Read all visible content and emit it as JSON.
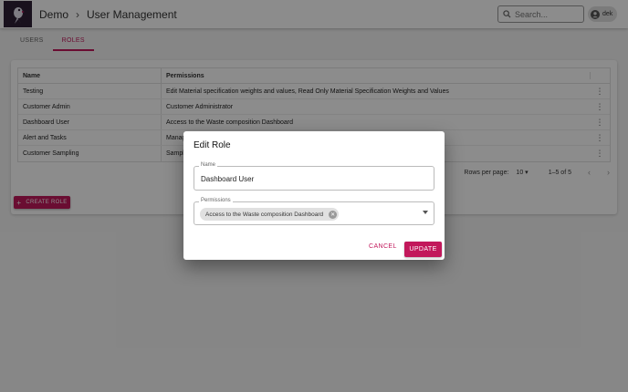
{
  "header": {
    "breadcrumb_root": "Demo",
    "breadcrumb_page": "User Management",
    "search_placeholder": "Search...",
    "user_initials": "dek"
  },
  "tabs": [
    {
      "label": "USERS",
      "active": false
    },
    {
      "label": "ROLES",
      "active": true
    }
  ],
  "table": {
    "columns": [
      "Name",
      "Permissions"
    ],
    "rows": [
      {
        "name": "Testing",
        "permissions": "Edit Material specification weights and values, Read Only Material Specification Weights and Values"
      },
      {
        "name": "Customer Admin",
        "permissions": "Customer Administrator"
      },
      {
        "name": "Dashboard User",
        "permissions": "Access to the Waste composition Dashboard"
      },
      {
        "name": "Alert and Tasks",
        "permissions": "Manag"
      },
      {
        "name": "Customer Sampling",
        "permissions": "Sampl"
      }
    ],
    "pagination": {
      "rows_per_page_label": "Rows per page:",
      "rows_per_page_value": "10",
      "range": "1–5 of 5"
    }
  },
  "create_role_label": "CREATE ROLE",
  "dialog": {
    "title": "Edit Role",
    "name_label": "Name",
    "name_value": "Dashboard User",
    "permissions_label": "Permissions",
    "permission_chip": "Access to the Waste composition Dashboard",
    "cancel_label": "CANCEL",
    "update_label": "UPDATE"
  },
  "colors": {
    "accent": "#c2185b",
    "logo_bg": "#2e2036"
  }
}
